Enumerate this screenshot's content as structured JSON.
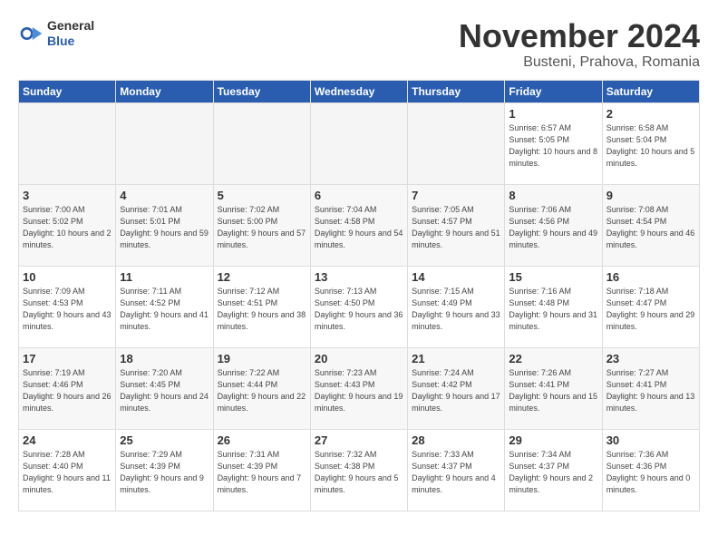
{
  "header": {
    "logo_general": "General",
    "logo_blue": "Blue",
    "month_title": "November 2024",
    "location": "Busteni, Prahova, Romania"
  },
  "weekdays": [
    "Sunday",
    "Monday",
    "Tuesday",
    "Wednesday",
    "Thursday",
    "Friday",
    "Saturday"
  ],
  "weeks": [
    [
      {
        "day": "",
        "empty": true
      },
      {
        "day": "",
        "empty": true
      },
      {
        "day": "",
        "empty": true
      },
      {
        "day": "",
        "empty": true
      },
      {
        "day": "",
        "empty": true
      },
      {
        "day": "1",
        "sunrise": "Sunrise: 6:57 AM",
        "sunset": "Sunset: 5:05 PM",
        "daylight": "Daylight: 10 hours and 8 minutes."
      },
      {
        "day": "2",
        "sunrise": "Sunrise: 6:58 AM",
        "sunset": "Sunset: 5:04 PM",
        "daylight": "Daylight: 10 hours and 5 minutes."
      }
    ],
    [
      {
        "day": "3",
        "sunrise": "Sunrise: 7:00 AM",
        "sunset": "Sunset: 5:02 PM",
        "daylight": "Daylight: 10 hours and 2 minutes."
      },
      {
        "day": "4",
        "sunrise": "Sunrise: 7:01 AM",
        "sunset": "Sunset: 5:01 PM",
        "daylight": "Daylight: 9 hours and 59 minutes."
      },
      {
        "day": "5",
        "sunrise": "Sunrise: 7:02 AM",
        "sunset": "Sunset: 5:00 PM",
        "daylight": "Daylight: 9 hours and 57 minutes."
      },
      {
        "day": "6",
        "sunrise": "Sunrise: 7:04 AM",
        "sunset": "Sunset: 4:58 PM",
        "daylight": "Daylight: 9 hours and 54 minutes."
      },
      {
        "day": "7",
        "sunrise": "Sunrise: 7:05 AM",
        "sunset": "Sunset: 4:57 PM",
        "daylight": "Daylight: 9 hours and 51 minutes."
      },
      {
        "day": "8",
        "sunrise": "Sunrise: 7:06 AM",
        "sunset": "Sunset: 4:56 PM",
        "daylight": "Daylight: 9 hours and 49 minutes."
      },
      {
        "day": "9",
        "sunrise": "Sunrise: 7:08 AM",
        "sunset": "Sunset: 4:54 PM",
        "daylight": "Daylight: 9 hours and 46 minutes."
      }
    ],
    [
      {
        "day": "10",
        "sunrise": "Sunrise: 7:09 AM",
        "sunset": "Sunset: 4:53 PM",
        "daylight": "Daylight: 9 hours and 43 minutes."
      },
      {
        "day": "11",
        "sunrise": "Sunrise: 7:11 AM",
        "sunset": "Sunset: 4:52 PM",
        "daylight": "Daylight: 9 hours and 41 minutes."
      },
      {
        "day": "12",
        "sunrise": "Sunrise: 7:12 AM",
        "sunset": "Sunset: 4:51 PM",
        "daylight": "Daylight: 9 hours and 38 minutes."
      },
      {
        "day": "13",
        "sunrise": "Sunrise: 7:13 AM",
        "sunset": "Sunset: 4:50 PM",
        "daylight": "Daylight: 9 hours and 36 minutes."
      },
      {
        "day": "14",
        "sunrise": "Sunrise: 7:15 AM",
        "sunset": "Sunset: 4:49 PM",
        "daylight": "Daylight: 9 hours and 33 minutes."
      },
      {
        "day": "15",
        "sunrise": "Sunrise: 7:16 AM",
        "sunset": "Sunset: 4:48 PM",
        "daylight": "Daylight: 9 hours and 31 minutes."
      },
      {
        "day": "16",
        "sunrise": "Sunrise: 7:18 AM",
        "sunset": "Sunset: 4:47 PM",
        "daylight": "Daylight: 9 hours and 29 minutes."
      }
    ],
    [
      {
        "day": "17",
        "sunrise": "Sunrise: 7:19 AM",
        "sunset": "Sunset: 4:46 PM",
        "daylight": "Daylight: 9 hours and 26 minutes."
      },
      {
        "day": "18",
        "sunrise": "Sunrise: 7:20 AM",
        "sunset": "Sunset: 4:45 PM",
        "daylight": "Daylight: 9 hours and 24 minutes."
      },
      {
        "day": "19",
        "sunrise": "Sunrise: 7:22 AM",
        "sunset": "Sunset: 4:44 PM",
        "daylight": "Daylight: 9 hours and 22 minutes."
      },
      {
        "day": "20",
        "sunrise": "Sunrise: 7:23 AM",
        "sunset": "Sunset: 4:43 PM",
        "daylight": "Daylight: 9 hours and 19 minutes."
      },
      {
        "day": "21",
        "sunrise": "Sunrise: 7:24 AM",
        "sunset": "Sunset: 4:42 PM",
        "daylight": "Daylight: 9 hours and 17 minutes."
      },
      {
        "day": "22",
        "sunrise": "Sunrise: 7:26 AM",
        "sunset": "Sunset: 4:41 PM",
        "daylight": "Daylight: 9 hours and 15 minutes."
      },
      {
        "day": "23",
        "sunrise": "Sunrise: 7:27 AM",
        "sunset": "Sunset: 4:41 PM",
        "daylight": "Daylight: 9 hours and 13 minutes."
      }
    ],
    [
      {
        "day": "24",
        "sunrise": "Sunrise: 7:28 AM",
        "sunset": "Sunset: 4:40 PM",
        "daylight": "Daylight: 9 hours and 11 minutes."
      },
      {
        "day": "25",
        "sunrise": "Sunrise: 7:29 AM",
        "sunset": "Sunset: 4:39 PM",
        "daylight": "Daylight: 9 hours and 9 minutes."
      },
      {
        "day": "26",
        "sunrise": "Sunrise: 7:31 AM",
        "sunset": "Sunset: 4:39 PM",
        "daylight": "Daylight: 9 hours and 7 minutes."
      },
      {
        "day": "27",
        "sunrise": "Sunrise: 7:32 AM",
        "sunset": "Sunset: 4:38 PM",
        "daylight": "Daylight: 9 hours and 5 minutes."
      },
      {
        "day": "28",
        "sunrise": "Sunrise: 7:33 AM",
        "sunset": "Sunset: 4:37 PM",
        "daylight": "Daylight: 9 hours and 4 minutes."
      },
      {
        "day": "29",
        "sunrise": "Sunrise: 7:34 AM",
        "sunset": "Sunset: 4:37 PM",
        "daylight": "Daylight: 9 hours and 2 minutes."
      },
      {
        "day": "30",
        "sunrise": "Sunrise: 7:36 AM",
        "sunset": "Sunset: 4:36 PM",
        "daylight": "Daylight: 9 hours and 0 minutes."
      }
    ]
  ]
}
